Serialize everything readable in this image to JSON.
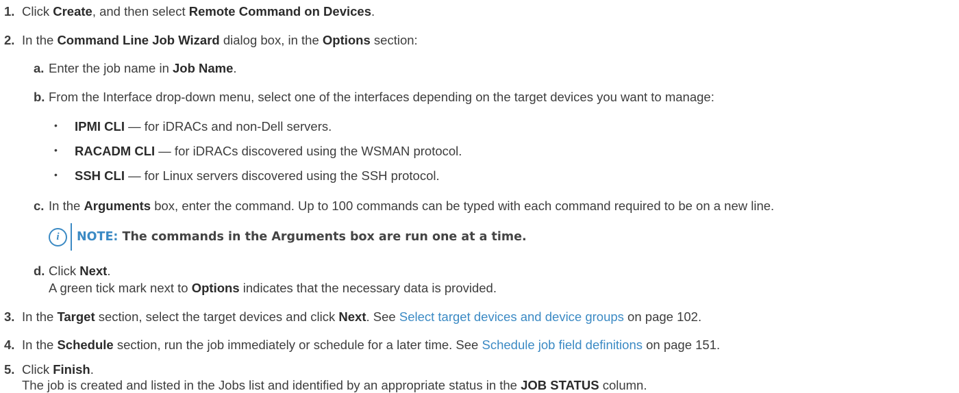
{
  "steps": {
    "s1": {
      "num": "1.",
      "t1": "Click ",
      "b1": "Create",
      "t2": ", and then select ",
      "b2": "Remote Command on Devices",
      "t3": "."
    },
    "s2": {
      "num": "2.",
      "t1": "In the ",
      "b1": "Command Line Job Wizard",
      "t2": " dialog box, in the ",
      "b2": "Options",
      "t3": " section:"
    },
    "s2a": {
      "num": "a.",
      "t1": "Enter the job name in ",
      "b1": "Job Name",
      "t2": "."
    },
    "s2b": {
      "num": "b.",
      "t1": "From the Interface drop-down menu, select one of the interfaces depending on the target devices you want to manage:"
    },
    "bullets": [
      {
        "b": "IPMI CLI",
        "t": " — for iDRACs and non-Dell servers."
      },
      {
        "b": "RACADM CLI",
        "t": " — for iDRACs discovered using the WSMAN protocol."
      },
      {
        "b": "SSH CLI",
        "t": " — for Linux servers discovered using the SSH protocol."
      }
    ],
    "s2c": {
      "num": "c.",
      "t1": "In the ",
      "b1": "Arguments",
      "t2": " box, enter the command. Up to 100 commands can be typed with each command required to be on a new line."
    },
    "note": {
      "icon": "i",
      "label": "NOTE:",
      "text": " The commands in the Arguments box are run one at a time."
    },
    "s2d": {
      "num": "d.",
      "t1": "Click ",
      "b1": "Next",
      "t2": ".",
      "l2_t1": "A green tick mark next to ",
      "l2_b1": "Options",
      "l2_t2": " indicates that the necessary data is provided."
    },
    "s3": {
      "num": "3.",
      "t1": "In the ",
      "b1": "Target",
      "t2": " section, select the target devices and click ",
      "b2": "Next",
      "t3": ". See ",
      "link": "Select target devices and device groups",
      "t4": " on page 102."
    },
    "s4": {
      "num": "4.",
      "t1": "In the ",
      "b1": "Schedule",
      "t2": " section, run the job immediately or schedule for a later time. See ",
      "link": "Schedule job field definitions",
      "t3": " on page 151."
    },
    "s5": {
      "num": "5.",
      "t1": "Click ",
      "b1": "Finish",
      "t2": ".",
      "l2_t1": "The job is created and listed in the Jobs list and identified by an appropriate status in the ",
      "l2_b1": "JOB STATUS",
      "l2_t2": " column."
    }
  },
  "colors": {
    "text": "#3d3d3d",
    "link": "#3b8ac4",
    "note_accent": "#3b8ac4"
  },
  "icons": {
    "note": "info-circle-icon"
  }
}
